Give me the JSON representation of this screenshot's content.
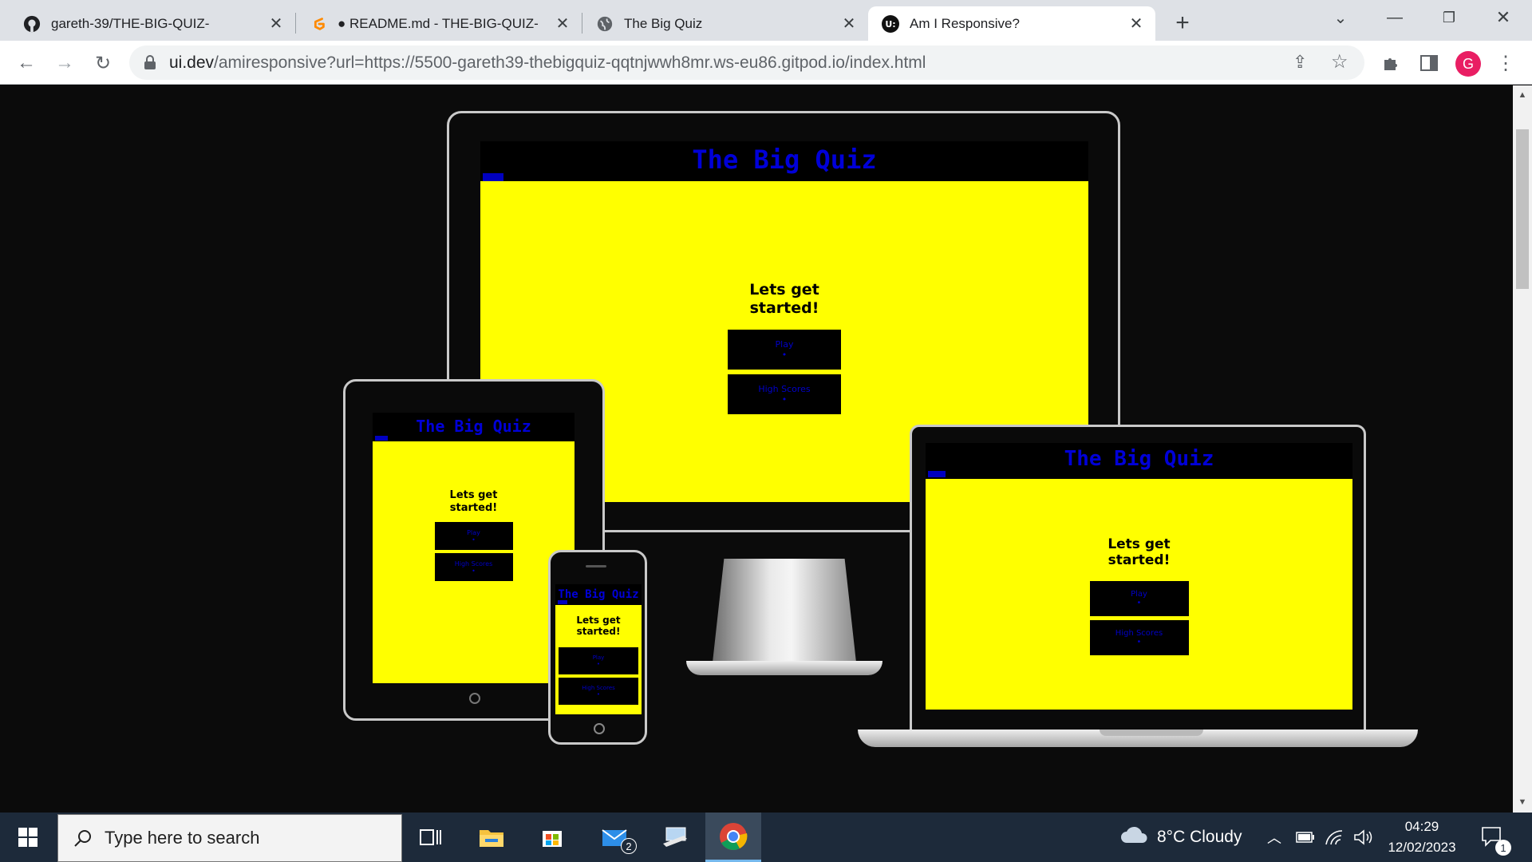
{
  "browser": {
    "tabs": [
      {
        "label": "gareth-39/THE-BIG-QUIZ-",
        "icon": "github-icon"
      },
      {
        "label": "● README.md - THE-BIG-QUIZ-",
        "icon": "gitpod-icon"
      },
      {
        "label": "The Big Quiz",
        "icon": "globe-icon"
      },
      {
        "label": "Am I Responsive?",
        "icon": "ui-dev-icon",
        "active": true
      }
    ],
    "url_main": "ui.dev",
    "url_rest": "/amiresponsive?url=https://5500-gareth39-thebigquiz-qqtnjwwh8mr.ws-eu86.gitpod.io/index.html",
    "profile_initial": "G"
  },
  "quiz": {
    "title": "The Big Quiz",
    "tagline_line1": "Lets get",
    "tagline_line2": "started!",
    "play_label": "Play",
    "highscores_label": "High Scores",
    "btn_dot": "•"
  },
  "taskbar": {
    "search_placeholder": "Type here to search",
    "mail_badge": "2",
    "weather": "8°C  Cloudy",
    "time": "04:29",
    "date": "12/02/2023",
    "notification_count": "1"
  },
  "colors": {
    "quiz_yellow": "#ffff00",
    "quiz_blue": "#0000d8",
    "taskbar": "#1d2a3a"
  }
}
